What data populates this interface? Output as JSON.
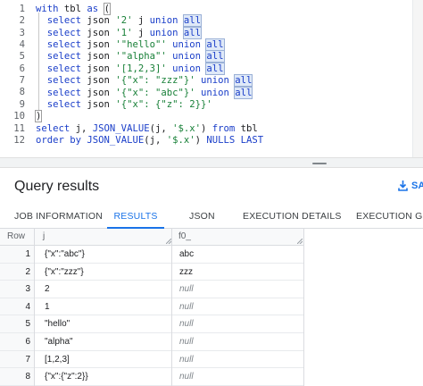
{
  "editor": {
    "lines": [
      {
        "num": "1",
        "html": "<span class=\"kw\">with</span> tbl <span class=\"kw\">as</span> <span class=\"paren-box\">(</span>"
      },
      {
        "num": "2",
        "html": "  <span class=\"kw\">select</span> json <span class=\"str\">'2'</span> j <span class=\"kw\">union</span> <span class=\"hl kw\">all</span>"
      },
      {
        "num": "3",
        "html": "  <span class=\"kw\">select</span> json <span class=\"str\">'1'</span> j <span class=\"kw\">union</span> <span class=\"hl kw\">all</span>"
      },
      {
        "num": "4",
        "html": "  <span class=\"kw\">select</span> json <span class=\"str\">'\"hello\"'</span> <span class=\"kw\">union</span> <span class=\"hl kw\">all</span>"
      },
      {
        "num": "5",
        "html": "  <span class=\"kw\">select</span> json <span class=\"str\">'\"alpha\"'</span> <span class=\"kw\">union</span> <span class=\"hl kw\">all</span>"
      },
      {
        "num": "6",
        "html": "  <span class=\"kw\">select</span> json <span class=\"str\">'[1,2,3]'</span> <span class=\"kw\">union</span> <span class=\"hl kw\">all</span>"
      },
      {
        "num": "7",
        "html": "  <span class=\"kw\">select</span> json <span class=\"str\">'{\"x\": \"zzz\"}'</span> <span class=\"kw\">union</span> <span class=\"hl kw\">all</span>"
      },
      {
        "num": "8",
        "html": "  <span class=\"kw\">select</span> json <span class=\"str\">'{\"x\": \"abc\"}'</span> <span class=\"kw\">union</span> <span class=\"hl kw\">all</span><span class=\"cursor\"></span>"
      },
      {
        "num": "9",
        "html": "  <span class=\"kw\">select</span> json <span class=\"str\">'{\"x\": {\"z\": 2}}'</span>"
      },
      {
        "num": "10",
        "html": "<span class=\"paren-box\">)</span>"
      },
      {
        "num": "11",
        "html": "<span class=\"kw\">select</span> j, <span class=\"fn\">JSON_VALUE</span>(j, <span class=\"str\">'$.x'</span>) <span class=\"kw\">from</span> tbl"
      },
      {
        "num": "12",
        "html": "<span class=\"kw\">order by</span> <span class=\"fn\">JSON_VALUE</span>(j, <span class=\"str\">'$.x'</span>) <span class=\"kw\">NULLS LAST</span>"
      }
    ]
  },
  "results": {
    "title": "Query results",
    "save_label": "SA"
  },
  "tabs": [
    {
      "label": "JOB INFORMATION",
      "active": false
    },
    {
      "label": "RESULTS",
      "active": true
    },
    {
      "label": "JSON",
      "active": false
    },
    {
      "label": "EXECUTION DETAILS",
      "active": false
    },
    {
      "label": "EXECUTION GRA",
      "active": false
    }
  ],
  "table": {
    "headers": {
      "row": "Row",
      "j": "j",
      "f0": "f0_"
    },
    "rows": [
      {
        "row": "1",
        "j": "{\"x\":\"abc\"}",
        "f0": "abc",
        "is_null": false
      },
      {
        "row": "2",
        "j": "{\"x\":\"zzz\"}",
        "f0": "zzz",
        "is_null": false
      },
      {
        "row": "3",
        "j": "2",
        "f0": "null",
        "is_null": true
      },
      {
        "row": "4",
        "j": "1",
        "f0": "null",
        "is_null": true
      },
      {
        "row": "5",
        "j": "\"hello\"",
        "f0": "null",
        "is_null": true
      },
      {
        "row": "6",
        "j": "\"alpha\"",
        "f0": "null",
        "is_null": true
      },
      {
        "row": "7",
        "j": "[1,2,3]",
        "f0": "null",
        "is_null": true
      },
      {
        "row": "8",
        "j": "{\"x\":{\"z\":2}}",
        "f0": "null",
        "is_null": true
      }
    ]
  }
}
